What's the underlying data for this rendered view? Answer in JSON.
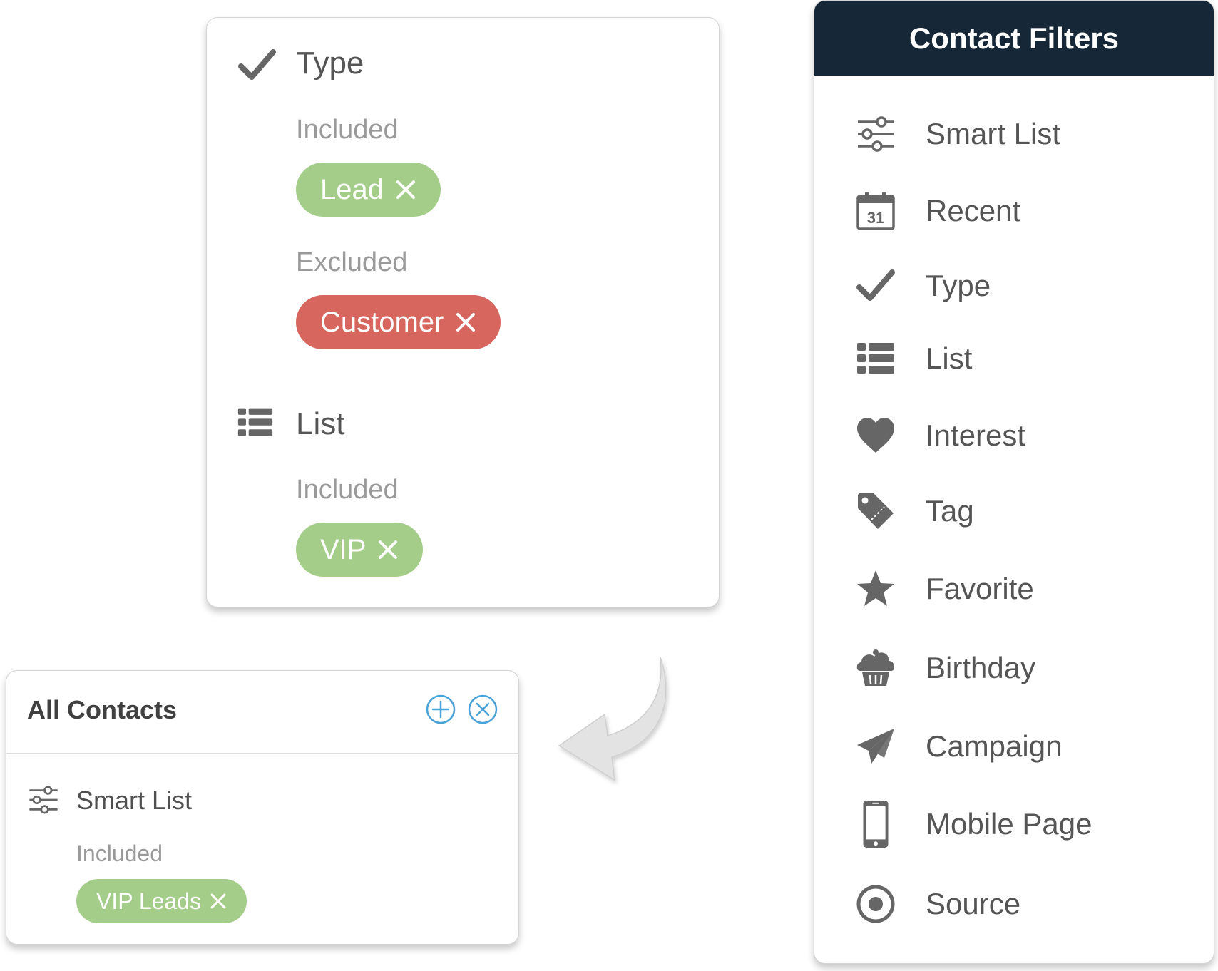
{
  "colors": {
    "included_chip": "#a5cd8a",
    "excluded_chip": "#d7665f",
    "panel_header": "#162838",
    "icon_gray": "#666666",
    "action_blue": "#4aa3d8"
  },
  "filter_detail": {
    "sections": [
      {
        "icon": "check-icon",
        "title": "Type",
        "groups": [
          {
            "label": "Included",
            "chips": [
              "Lead"
            ]
          },
          {
            "label": "Excluded",
            "chips": [
              "Customer"
            ]
          }
        ]
      },
      {
        "icon": "list-icon",
        "title": "List",
        "groups": [
          {
            "label": "Included",
            "chips": [
              "VIP"
            ]
          }
        ]
      }
    ]
  },
  "all_contacts": {
    "title": "All Contacts",
    "add_icon": "plus-circle-icon",
    "clear_icon": "x-circle-icon",
    "section_icon": "sliders-icon",
    "section_title": "Smart List",
    "group_label": "Included",
    "chip": "VIP Leads"
  },
  "contact_filters": {
    "title": "Contact Filters",
    "items": [
      {
        "icon": "sliders-icon",
        "label": "Smart List"
      },
      {
        "icon": "calendar-icon",
        "label": "Recent",
        "calendar_day": "31"
      },
      {
        "icon": "check-icon",
        "label": "Type"
      },
      {
        "icon": "list-icon",
        "label": "List"
      },
      {
        "icon": "heart-icon",
        "label": "Interest"
      },
      {
        "icon": "tag-icon",
        "label": "Tag"
      },
      {
        "icon": "star-icon",
        "label": "Favorite"
      },
      {
        "icon": "cupcake-icon",
        "label": "Birthday"
      },
      {
        "icon": "paper-plane-icon",
        "label": "Campaign"
      },
      {
        "icon": "mobile-phone-icon",
        "label": "Mobile Page"
      },
      {
        "icon": "target-icon",
        "label": "Source"
      }
    ]
  }
}
